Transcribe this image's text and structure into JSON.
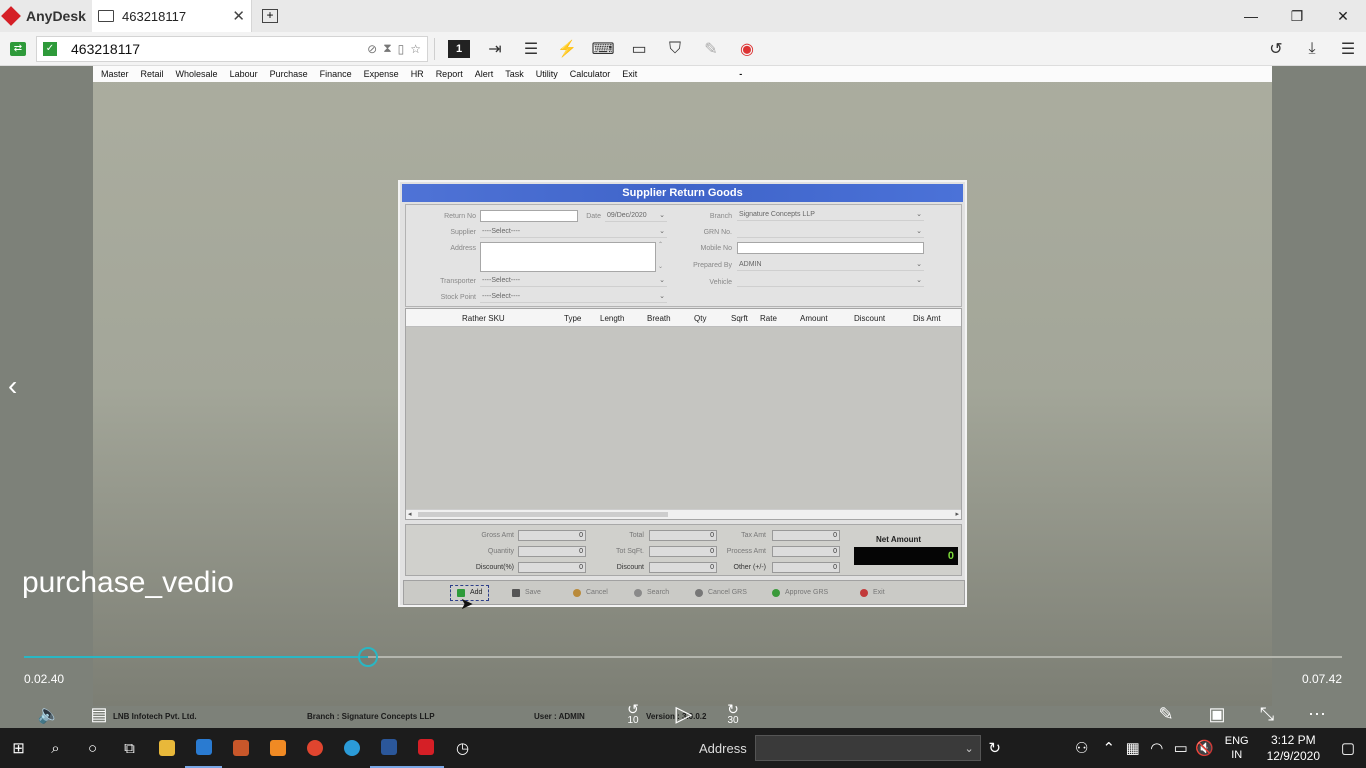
{
  "anydesk": {
    "app_name": "AnyDesk",
    "tab_label": "463218117",
    "address": "463218117",
    "screen_number": "1"
  },
  "remote": {
    "menu": [
      "Master",
      "Retail",
      "Wholesale",
      "Labour",
      "Purchase",
      "Finance",
      "Expense",
      "HR",
      "Report",
      "Alert",
      "Task",
      "Utility",
      "Calculator",
      "Exit"
    ],
    "menu_dash": "-",
    "dialog": {
      "title": "Supplier Return Goods",
      "labels": {
        "return_no": "Return No",
        "date": "Date",
        "supplier": "Supplier",
        "address": "Address",
        "transporter": "Transporter",
        "stock_point": "Stock Point",
        "branch": "Branch",
        "grn_no": "GRN No.",
        "mobile_no": "Mobile No",
        "prepared_by": "Prepared By",
        "vehicle": "Vehicle"
      },
      "values": {
        "date": "09/Dec/2020",
        "supplier": "----Select----",
        "transporter": "----Select----",
        "stock_point": "----Select----",
        "branch": "Signature Concepts LLP",
        "prepared_by": "ADMIN"
      },
      "grid_columns": [
        "Rather SKU",
        "Type",
        "Length",
        "Breath",
        "Qty",
        "Sqrft",
        "Rate",
        "Amount",
        "Discount",
        "Dis Amt"
      ],
      "totals_labels": {
        "gross_amt": "Gross Amt",
        "quantity": "Quantity",
        "discount_pct": "Discount(%)",
        "total": "Total",
        "tot_sqft": "Tot SqFt.",
        "discount": "Discount",
        "tax_amt": "Tax Amt",
        "process_amt": "Process Amt",
        "other": "Other (+/-)"
      },
      "totals_values": {
        "gross_amt": "0",
        "quantity": "0",
        "discount_pct": "0",
        "total": "0",
        "tot_sqft": "0",
        "discount": "0",
        "tax_amt": "0",
        "process_amt": "0",
        "other": "0"
      },
      "net_amount_label": "Net Amount",
      "net_amount_value": "0",
      "buttons": {
        "add": "Add",
        "save": "Save",
        "cancel": "Cancel",
        "search": "Search",
        "cancel_grs": "Cancel GRS",
        "approve_grs": "Approve GRS",
        "exit": "Exit"
      }
    },
    "status": {
      "company": "LNB Infotech Pvt. Ltd.",
      "branch": "Branch : Signature Concepts LLP",
      "user": "User : ADMIN",
      "version": "Version : 3.0.0.2"
    }
  },
  "video": {
    "title": "purchase_vedio",
    "current_time": "0.02.40",
    "total_time": "0.07.42",
    "progress_fraction": 0.261,
    "rewind_label": "10",
    "forward_label": "30"
  },
  "taskbar": {
    "address_label": "Address",
    "lang_line1": "ENG",
    "lang_line2": "IN",
    "time": "3:12 PM",
    "date": "12/9/2020"
  },
  "colors": {
    "accent_timeline": "#29b7c4",
    "dialog_title": "#4f73d6",
    "net_amount_text": "#7bd83a",
    "anydesk_red": "#d51f26"
  }
}
